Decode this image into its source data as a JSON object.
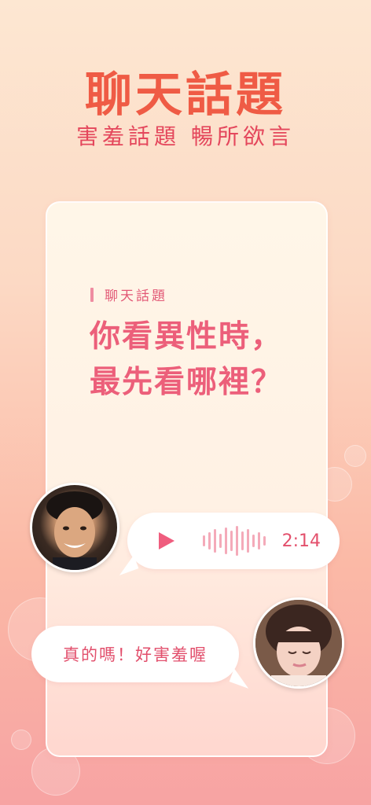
{
  "header": {
    "title": "聊天話題",
    "subtitle": "害羞話題 暢所欲言"
  },
  "card": {
    "section_label": "聊天話題",
    "question_line1": "你看異性時，",
    "question_line2": "最先看哪裡？"
  },
  "voice_message": {
    "duration": "2:14",
    "icon": "play-icon"
  },
  "reply_message": {
    "text": "真的嗎！好害羞喔"
  },
  "colors": {
    "title": "#ef5b45",
    "accent": "#ec5f7a",
    "wave": "#f4aab9"
  }
}
